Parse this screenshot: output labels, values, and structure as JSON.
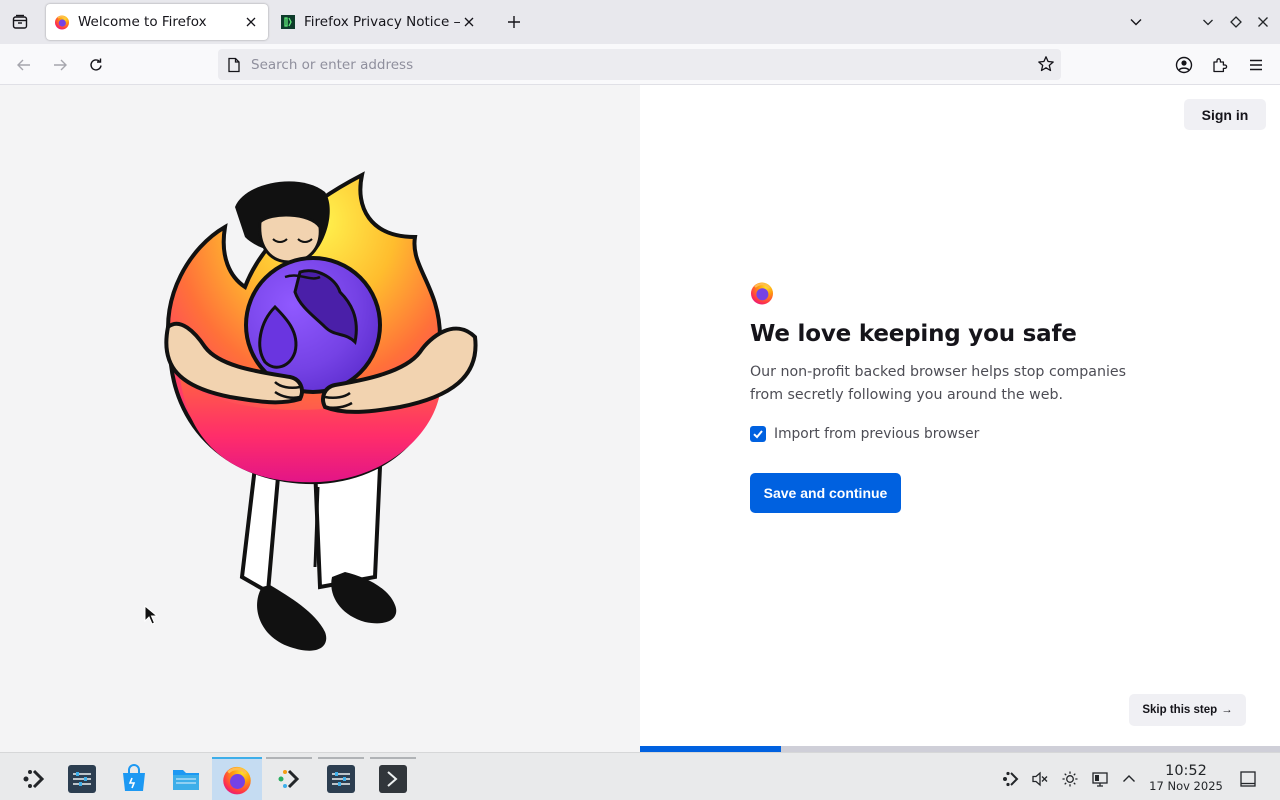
{
  "browser": {
    "tabs": [
      {
        "title": "Welcome to Firefox",
        "favicon": "firefox-icon",
        "active": true
      },
      {
        "title": "Firefox Privacy Notice — M",
        "favicon": "mozilla-icon",
        "active": false
      }
    ],
    "address_bar": {
      "placeholder": "Search or enter address",
      "value": ""
    },
    "accent_color": "#0061e0"
  },
  "page": {
    "sign_in_label": "Sign in",
    "heading": "We love keeping you safe",
    "description": "Our non-profit backed browser helps stop companies from secretly following you around the web.",
    "import_checkbox": {
      "label": "Import from previous browser",
      "checked": true
    },
    "primary_button": "Save and continue",
    "skip_button": "Skip this step",
    "skip_arrow": "→",
    "progress": 0.22
  },
  "taskbar": {
    "apps": [
      {
        "name": "kde-menu-icon",
        "state": "none"
      },
      {
        "name": "system-settings-icon",
        "state": "none"
      },
      {
        "name": "discover-store-icon",
        "state": "none"
      },
      {
        "name": "file-manager-icon",
        "state": "none"
      },
      {
        "name": "firefox-icon",
        "state": "active"
      },
      {
        "name": "kdeconnect-icon",
        "state": "open"
      },
      {
        "name": "system-settings-icon",
        "state": "open"
      },
      {
        "name": "terminal-icon",
        "state": "open"
      }
    ],
    "clock": {
      "time": "10:52",
      "date": "17 Nov 2025"
    }
  }
}
